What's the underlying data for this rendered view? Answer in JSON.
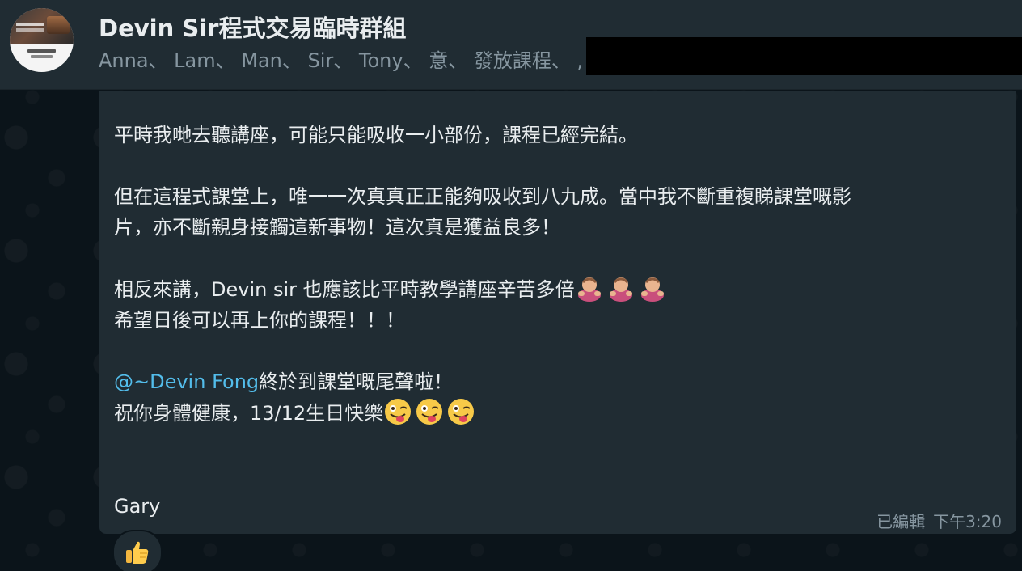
{
  "header": {
    "title": "Devin Sir程式交易臨時群組",
    "members": "Anna、 Lam、 Man、 Sir、 Tony、 意、 發放課程、 ,"
  },
  "message": {
    "line1": "平時我哋去聽講座，可能只能吸收一小部份，課程已經完結。",
    "line2": "但在這程式課堂上，唯一一次真真正正能夠吸收到八九成。當中我不斷重複睇課堂嘅影",
    "line3": "片，亦不斷親身接觸這新事物！這次真是獲益良多！",
    "line4": "相反來講，Devin sir 也應該比平時教學講座辛苦多倍",
    "line5": "希望日後可以再上你的課程！！！",
    "mention": "@~Devin Fong",
    "line6_after_mention": "終於到課堂嘅尾聲啦！",
    "line7": "祝你身體健康，13/12生日快樂",
    "signature": "Gary",
    "edited_label": "已編輯",
    "time": "下午3:20"
  },
  "reaction": {
    "emoji": "thumbs-up-icon"
  },
  "colors": {
    "background": "#0b141a",
    "header_bg": "#202c33",
    "bubble_bg": "#202c33",
    "text": "#e9edef",
    "muted": "#8696a0",
    "mention": "#53bdeb"
  }
}
